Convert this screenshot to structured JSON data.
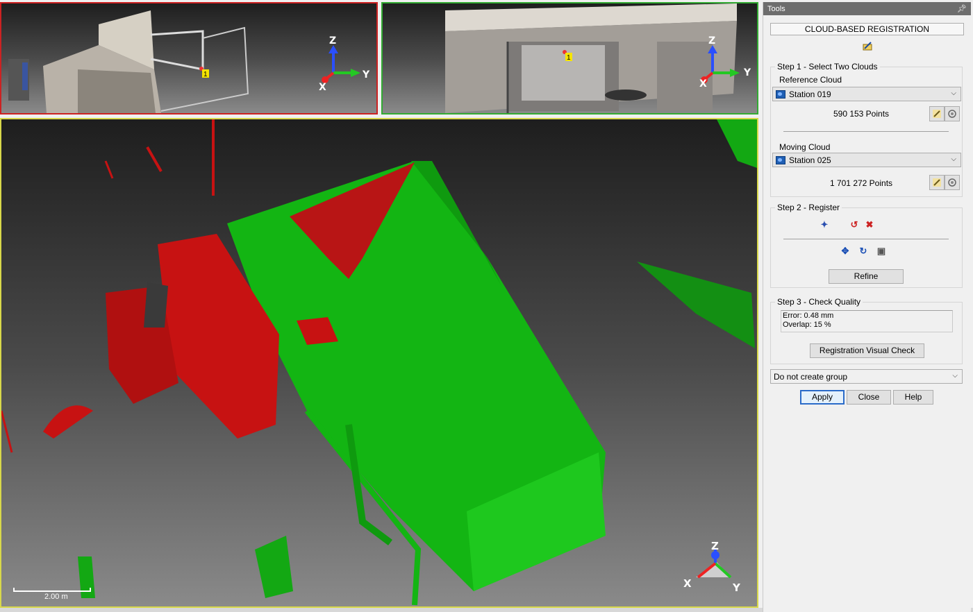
{
  "panel": {
    "header": "Tools",
    "title": "CLOUD-BASED REGISTRATION",
    "step1": {
      "title": "Step 1 - Select Two Clouds",
      "reference_label": "Reference Cloud",
      "reference_value": "Station 019",
      "reference_points": "590 153  Points",
      "moving_label": "Moving Cloud",
      "moving_value": "Station 025",
      "moving_points": "1 701 272  Points"
    },
    "step2": {
      "title": "Step 2 - Register",
      "refine_label": "Refine"
    },
    "step3": {
      "title": "Step 3 - Check Quality",
      "error_text": "Error: 0.48 mm",
      "overlap_text": "Overlap: 15 %",
      "visual_check_label": "Registration Visual Check"
    },
    "group_option": "Do not create group",
    "buttons": {
      "apply": "Apply",
      "close": "Close",
      "help": "Help"
    }
  },
  "viewports": {
    "left": {
      "axes": {
        "z": "Z",
        "x": "X",
        "y": "Y"
      },
      "marker": "1"
    },
    "right": {
      "axes": {
        "z": "Z",
        "x": "X",
        "y": "Y"
      },
      "marker": "1"
    },
    "main": {
      "axes": {
        "z": "Z",
        "x": "X",
        "y": "Y"
      },
      "scale_label": "2.00 m"
    }
  },
  "colors": {
    "reference_cloud": "#cc1111",
    "moving_cloud": "#13b513",
    "left_border": "#cc2222",
    "right_border": "#33aa33",
    "main_border": "#d8d84a"
  }
}
